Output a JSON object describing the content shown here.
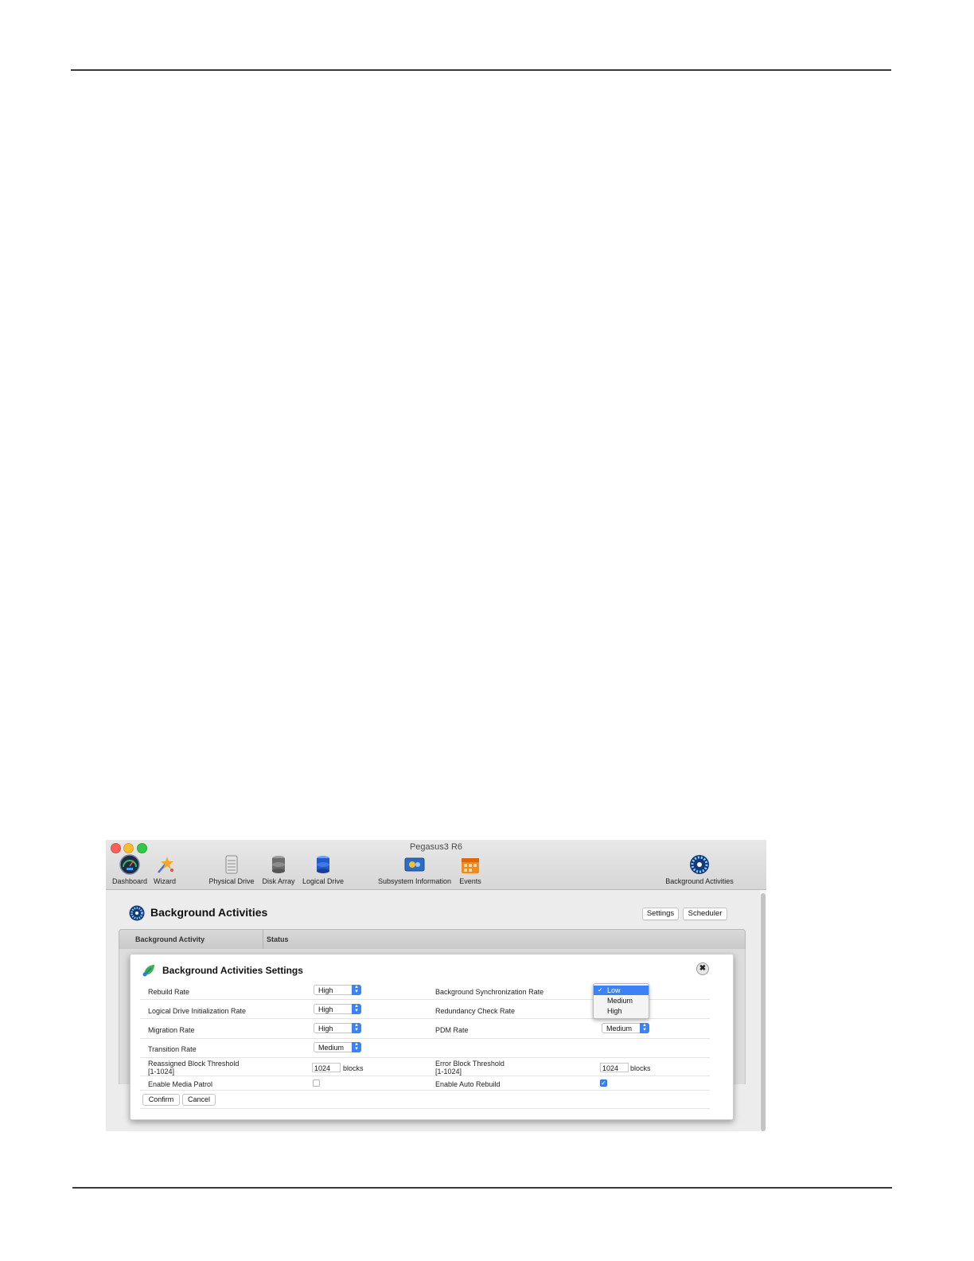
{
  "window": {
    "title": "Pegasus3 R6"
  },
  "toolbar": {
    "items": [
      {
        "label": "Dashboard",
        "icon": "dashboard-gauge-icon"
      },
      {
        "label": "Wizard",
        "icon": "wizard-star-icon"
      },
      {
        "label": "Physical Drive",
        "icon": "physical-drive-icon"
      },
      {
        "label": "Disk Array",
        "icon": "disk-array-icon"
      },
      {
        "label": "Logical Drive",
        "icon": "logical-drive-icon"
      },
      {
        "label": "Subsystem Information",
        "icon": "subsystem-info-icon"
      },
      {
        "label": "Events",
        "icon": "events-calendar-icon"
      },
      {
        "label": "Background Activities",
        "icon": "background-activities-icon"
      }
    ]
  },
  "page": {
    "title": "Background Activities",
    "settings_label": "Settings",
    "scheduler_label": "Scheduler"
  },
  "table": {
    "columns": [
      "Background Activity",
      "Status"
    ]
  },
  "dialog": {
    "title": "Background Activities Settings",
    "close_glyph": "✖",
    "left": {
      "rebuild_rate": {
        "label": "Rebuild Rate",
        "value": "High"
      },
      "init_rate": {
        "label": "Logical Drive Initialization Rate",
        "value": "High"
      },
      "migration_rate": {
        "label": "Migration Rate",
        "value": "High"
      },
      "transition_rate": {
        "label": "Transition Rate",
        "value": "Medium"
      },
      "reassigned_threshold": {
        "label": "Reassigned Block Threshold",
        "range": "[1-1024]",
        "value": "1024",
        "unit": "blocks"
      },
      "media_patrol": {
        "label": "Enable Media Patrol",
        "checked": false
      }
    },
    "right": {
      "sync_rate": {
        "label": "Background Synchronization Rate",
        "value": "Low"
      },
      "redundancy_rate": {
        "label": "Redundancy Check Rate"
      },
      "pdm_rate": {
        "label": "PDM Rate",
        "value": "Medium"
      },
      "error_threshold": {
        "label": "Error Block Threshold",
        "range": "[1-1024]",
        "value": "1024",
        "unit": "blocks"
      },
      "auto_rebuild": {
        "label": "Enable Auto Rebuild",
        "checked": true
      }
    },
    "dropdown_options": [
      "Low",
      "Medium",
      "High"
    ],
    "dropdown_selected": "Low",
    "confirm_label": "Confirm",
    "cancel_label": "Cancel"
  }
}
